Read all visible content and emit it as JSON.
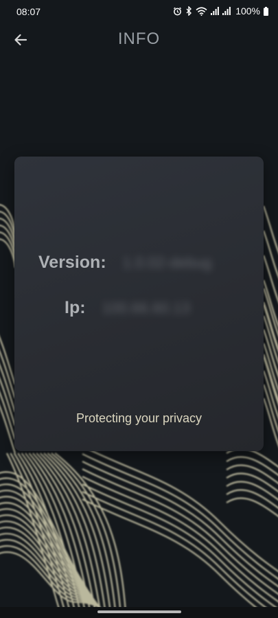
{
  "status_bar": {
    "time": "08:07",
    "battery": "100%",
    "icons": [
      "alarm-icon",
      "bluetooth-icon",
      "wifi-icon",
      "signal-icon",
      "signal-icon",
      "battery-icon"
    ]
  },
  "app_bar": {
    "title": "INFO",
    "back_icon": "arrow-left-icon"
  },
  "info_card": {
    "version_label": "Version:",
    "version_value": "1.0.02-debug",
    "ip_label": "Ip:",
    "ip_value": "100.66.60.13",
    "tagline": "Protecting your privacy"
  },
  "colors": {
    "background": "#14181c",
    "card": "#2c2f35",
    "wave_lines": "#d8d4b4",
    "tagline": "#dcd7c0"
  }
}
